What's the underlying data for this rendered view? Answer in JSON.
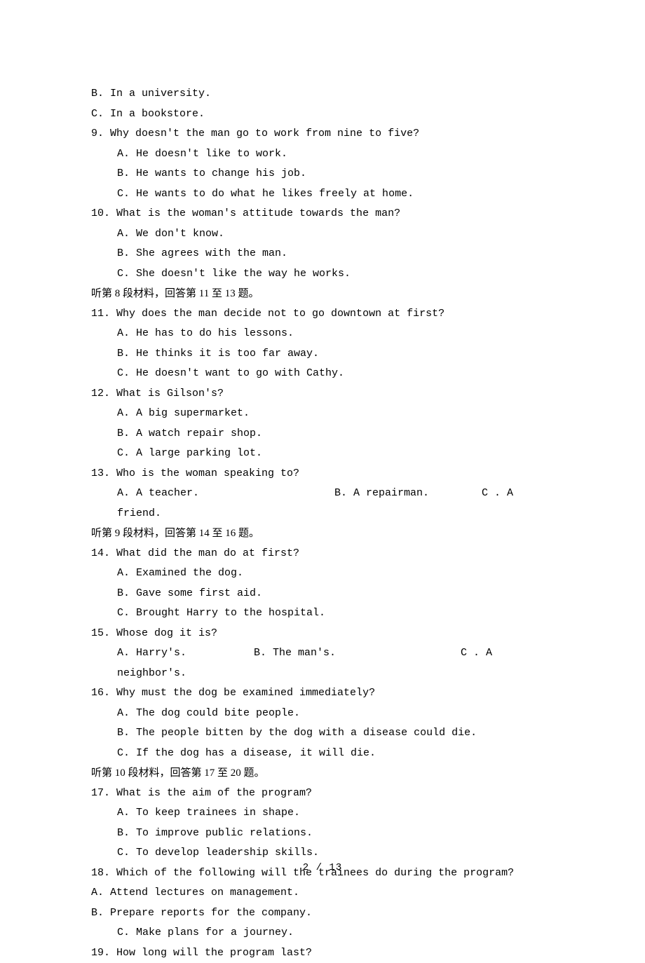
{
  "q8": {
    "option_b": "B. In a university.",
    "option_c": "C. In a bookstore."
  },
  "q9": {
    "stem": "9. Why doesn't the man go to work from nine to five?",
    "option_a": "A. He doesn't like to work.",
    "option_b": "B. He wants to change his job.",
    "option_c": "C. He wants to do what he likes freely at home."
  },
  "q10": {
    "stem": "10. What is the woman's attitude towards the man?",
    "option_a": "A. We don't know.",
    "option_b": "B. She agrees with the man.",
    "option_c": "C. She doesn't like the way he works."
  },
  "section8": "听第 8 段材料，回答第 11 至 13 题。",
  "q11": {
    "stem": "11. Why does the man decide not to go downtown at first?",
    "option_a": "A. He has to do his lessons.",
    "option_b": "B. He thinks it is too far away.",
    "option_c": "C. He doesn't want to go with Cathy."
  },
  "q12": {
    "stem": "12. What is Gilson's?",
    "option_a": "A. A big supermarket.",
    "option_b": "B. A watch repair shop.",
    "option_c": "C. A large parking lot."
  },
  "q13": {
    "stem": "13. Who is the woman speaking to?",
    "option_a": "A. A teacher.",
    "option_b": "B. A repairman.",
    "option_c": "C .  A",
    "wrap": "friend."
  },
  "section9": "听第 9 段材料，回答第 14 至 16 题。",
  "q14": {
    "stem": "14. What did the man do at first?",
    "option_a": "A. Examined the dog.",
    "option_b": "B. Gave some first aid.",
    "option_c": "C. Brought Harry to the hospital."
  },
  "q15": {
    "stem": "15. Whose dog it is?",
    "option_a": "A. Harry's.",
    "option_b": "B. The man's.",
    "option_c": "C    .    A",
    "wrap": "neighbor's."
  },
  "q16": {
    "stem": "16. Why must the dog be examined immediately?",
    "option_a": "A. The dog could bite people.",
    "option_b": "B. The people bitten by the dog with a disease could die.",
    "option_c": "C. If the dog has a disease, it will die."
  },
  "section10": "听第 10 段材料，回答第 17 至 20 题。",
  "q17": {
    "stem": "17. What is the aim of the program?",
    "option_a": "A. To keep trainees in shape.",
    "option_b": "B. To improve public relations.",
    "option_c": "C. To develop leadership skills."
  },
  "q18": {
    "stem": "18. Which of the following will the trainees do during the program?",
    "option_a": "A. Attend lectures on management.",
    "option_b": "B. Prepare reports for the company.",
    "option_c": "C. Make plans for a journey."
  },
  "q19": {
    "stem": "19. How long will the program last?"
  },
  "footer": "2 / 13"
}
